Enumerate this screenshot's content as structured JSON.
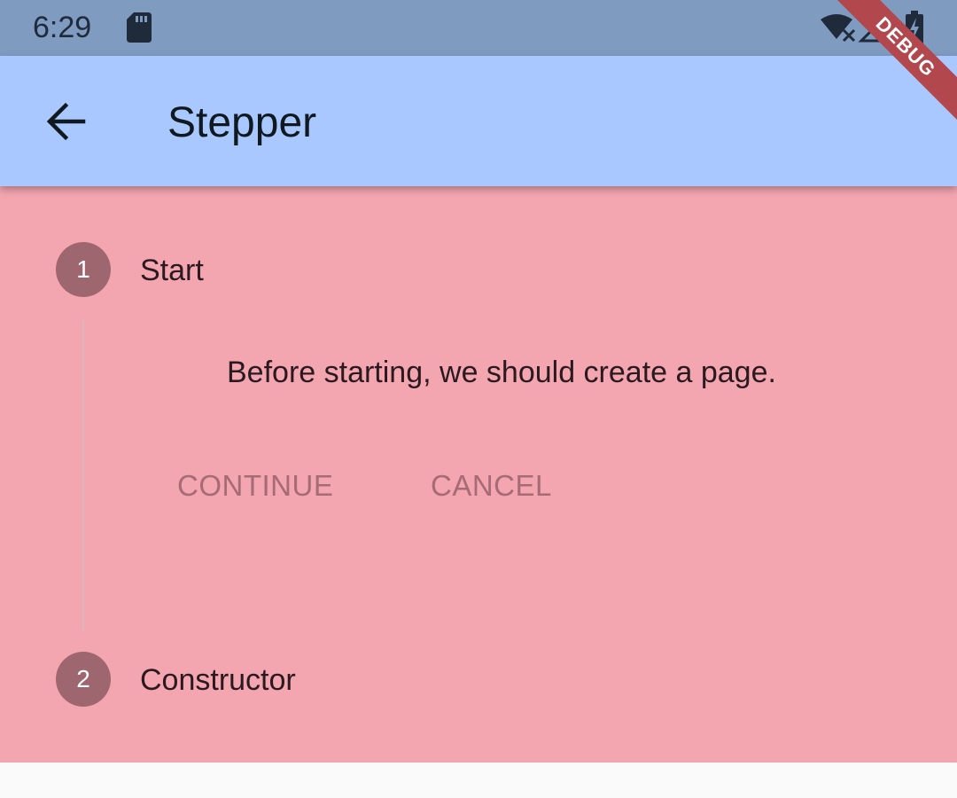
{
  "status_bar": {
    "time": "6:29",
    "icons": [
      "sd-card-icon",
      "wifi-off-icon",
      "signal-icon",
      "battery-charging-icon"
    ]
  },
  "app_bar": {
    "title": "Stepper",
    "back_icon": "arrow-left-icon"
  },
  "debug_banner": {
    "label": "DEBUG"
  },
  "stepper": {
    "steps": [
      {
        "number": "1",
        "title": "Start"
      },
      {
        "number": "2",
        "title": "Constructor"
      }
    ],
    "active_content": "Before starting, we should create a page.",
    "continue_label": "CONTINUE",
    "cancel_label": "CANCEL"
  },
  "colors": {
    "status_bar": "#7f9bc0",
    "app_bar": "#a8c8ff",
    "content_bg": "#f3a5b0",
    "step_circle": "#9e6770",
    "button_text": "#a56c76",
    "debug_ribbon": "#b2474d"
  }
}
